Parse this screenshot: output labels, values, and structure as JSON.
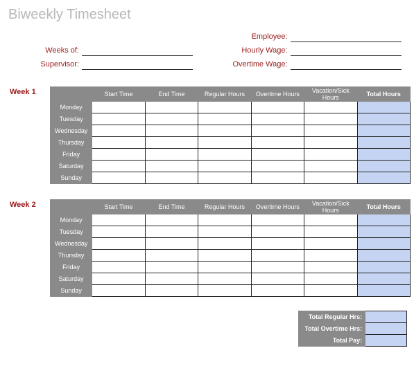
{
  "title": "Biweekly Timesheet",
  "header": {
    "weeks_of": "Weeks of:",
    "supervisor": "Supervisor:",
    "employee": "Employee:",
    "hourly_wage": "Hourly Wage:",
    "overtime_wage": "Overtime Wage:"
  },
  "weeks": [
    {
      "label": "Week 1"
    },
    {
      "label": "Week 2"
    }
  ],
  "columns": {
    "start": "Start Time",
    "end": "End Time",
    "regular": "Regular Hours",
    "overtime": "Overtime Hours",
    "vacation": "Vacation/Sick Hours",
    "total": "Total Hours"
  },
  "days": [
    "Monday",
    "Tuesday",
    "Wednesday",
    "Thursday",
    "Friday",
    "Saturday",
    "Sunday"
  ],
  "summary": {
    "regular": "Total Regular Hrs:",
    "overtime": "Total Overtime Hrs:",
    "pay": "Total Pay:"
  }
}
